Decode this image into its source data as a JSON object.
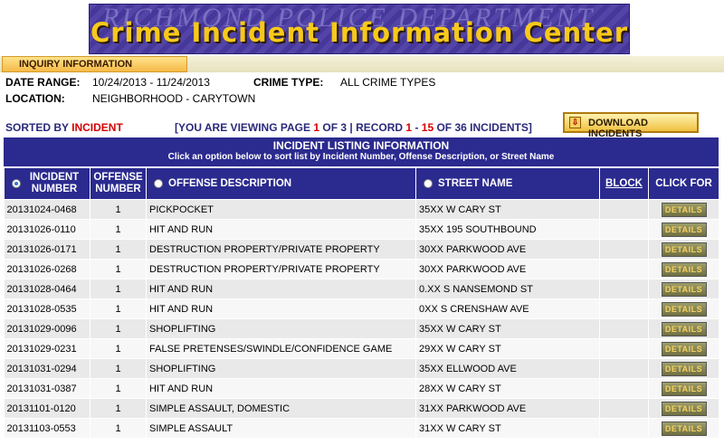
{
  "banner": {
    "watermark": "RICHMOND POLICE DEPARTMENT",
    "title": "Crime Incident Information Center"
  },
  "inquiry": {
    "tab_label": "INQUIRY INFORMATION",
    "date_range_label": "DATE RANGE:",
    "date_range_value": "10/24/2013 - 11/24/2013",
    "crime_type_label": "CRIME TYPE:",
    "crime_type_value": "ALL CRIME TYPES",
    "location_label": "LOCATION:",
    "location_value": "NEIGHBORHOOD - CARYTOWN"
  },
  "sorted": {
    "prefix": "SORTED BY ",
    "value": "INCIDENT"
  },
  "viewing": {
    "p1": "[YOU ARE VIEWING PAGE ",
    "page": "1",
    "p2": " OF 3 | RECORD ",
    "rec_start": "1",
    "p3": " - ",
    "rec_end": "15",
    "p4": " OF 36 INCIDENTS]"
  },
  "download": {
    "label": "DOWNLOAD INCIDENTS"
  },
  "listing": {
    "title": "INCIDENT LISTING INFORMATION",
    "subtitle": "Click an option below to sort list by Incident Number, Offense Description, or Street Name"
  },
  "columns": {
    "incident": "INCIDENT NUMBER",
    "offense_number": "OFFENSE NUMBER",
    "description": "OFFENSE DESCRIPTION",
    "street": "STREET NAME",
    "block": "BLOCK",
    "click": "CLICK FOR"
  },
  "details_label": "DETAILS",
  "rows": [
    {
      "incident": "20131024-0468",
      "offense": "1",
      "description": "PICKPOCKET",
      "street": "35XX W CARY ST"
    },
    {
      "incident": "20131026-0110",
      "offense": "1",
      "description": "HIT AND RUN",
      "street": "35XX 195 SOUTHBOUND"
    },
    {
      "incident": "20131026-0171",
      "offense": "1",
      "description": "DESTRUCTION PROPERTY/PRIVATE PROPERTY",
      "street": "30XX PARKWOOD AVE"
    },
    {
      "incident": "20131026-0268",
      "offense": "1",
      "description": "DESTRUCTION PROPERTY/PRIVATE PROPERTY",
      "street": "30XX PARKWOOD AVE"
    },
    {
      "incident": "20131028-0464",
      "offense": "1",
      "description": "HIT AND RUN",
      "street": "0.XX S NANSEMOND ST"
    },
    {
      "incident": "20131028-0535",
      "offense": "1",
      "description": "HIT AND RUN",
      "street": "0XX S CRENSHAW AVE"
    },
    {
      "incident": "20131029-0096",
      "offense": "1",
      "description": "SHOPLIFTING",
      "street": "35XX W CARY ST"
    },
    {
      "incident": "20131029-0231",
      "offense": "1",
      "description": "FALSE PRETENSES/SWINDLE/CONFIDENCE GAME",
      "street": "29XX W CARY ST"
    },
    {
      "incident": "20131031-0294",
      "offense": "1",
      "description": "SHOPLIFTING",
      "street": "35XX ELLWOOD AVE"
    },
    {
      "incident": "20131031-0387",
      "offense": "1",
      "description": "HIT AND RUN",
      "street": "28XX W CARY ST"
    },
    {
      "incident": "20131101-0120",
      "offense": "1",
      "description": "SIMPLE ASSAULT, DOMESTIC",
      "street": "31XX PARKWOOD AVE"
    },
    {
      "incident": "20131103-0553",
      "offense": "1",
      "description": "SIMPLE ASSAULT",
      "street": "31XX W CARY ST"
    }
  ]
}
